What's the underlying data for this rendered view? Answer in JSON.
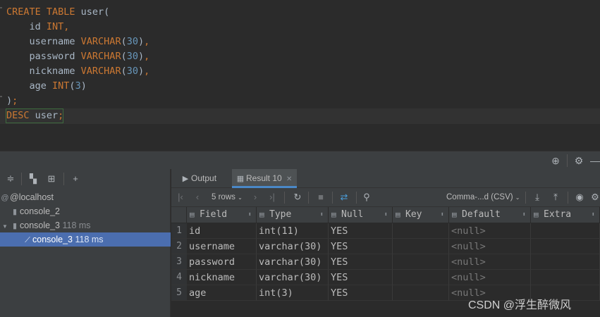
{
  "editor": {
    "lines": [
      [
        {
          "t": "CREATE TABLE ",
          "c": "kw"
        },
        {
          "t": "user(",
          "c": ""
        }
      ],
      [
        {
          "t": "    id ",
          "c": ""
        },
        {
          "t": "INT",
          "c": "kw"
        },
        {
          "t": ",",
          "c": "kw"
        }
      ],
      [
        {
          "t": "    username ",
          "c": ""
        },
        {
          "t": "VARCHAR",
          "c": "kw"
        },
        {
          "t": "(",
          "c": ""
        },
        {
          "t": "30",
          "c": "num"
        },
        {
          "t": ")",
          "c": ""
        },
        {
          "t": ",",
          "c": "kw"
        }
      ],
      [
        {
          "t": "    password ",
          "c": ""
        },
        {
          "t": "VARCHAR",
          "c": "kw"
        },
        {
          "t": "(",
          "c": ""
        },
        {
          "t": "30",
          "c": "num"
        },
        {
          "t": ")",
          "c": ""
        },
        {
          "t": ",",
          "c": "kw"
        }
      ],
      [
        {
          "t": "    nickname ",
          "c": ""
        },
        {
          "t": "VARCHAR",
          "c": "kw"
        },
        {
          "t": "(",
          "c": ""
        },
        {
          "t": "30",
          "c": "num"
        },
        {
          "t": ")",
          "c": ""
        },
        {
          "t": ",",
          "c": "kw"
        }
      ],
      [
        {
          "t": "    age ",
          "c": ""
        },
        {
          "t": "INT",
          "c": "kw"
        },
        {
          "t": "(",
          "c": ""
        },
        {
          "t": "3",
          "c": "num"
        },
        {
          "t": ")",
          "c": ""
        }
      ],
      [
        {
          "t": ")",
          "c": ""
        },
        {
          "t": ";",
          "c": "kw"
        }
      ],
      [
        {
          "t": "DESC ",
          "c": "kw"
        },
        {
          "t": "user",
          "c": ""
        },
        {
          "t": ";",
          "c": "kw"
        }
      ]
    ]
  },
  "tree": {
    "host": "@localhost",
    "console2": "console_2",
    "console3": "console_3",
    "console3_time": "118 ms",
    "session_label": "console_3",
    "session_time": "118 ms"
  },
  "tabs": {
    "output": "Output",
    "result": "Result 10"
  },
  "toolbar": {
    "rows": "5 rows",
    "export_format": "Comma-...d (CSV)"
  },
  "grid": {
    "columns": [
      "Field",
      "Type",
      "Null",
      "Key",
      "Default",
      "Extra"
    ],
    "rows": [
      [
        "1",
        "id",
        "int(11)",
        "YES",
        "",
        "<null>",
        ""
      ],
      [
        "2",
        "username",
        "varchar(30)",
        "YES",
        "",
        "<null>",
        ""
      ],
      [
        "3",
        "password",
        "varchar(30)",
        "YES",
        "",
        "<null>",
        ""
      ],
      [
        "4",
        "nickname",
        "varchar(30)",
        "YES",
        "",
        "<null>",
        ""
      ],
      [
        "5",
        "age",
        "int(3)",
        "YES",
        "",
        "<null>",
        ""
      ]
    ]
  },
  "watermark": "CSDN @浮生醉微风",
  "icons": [
    "gutter-tick",
    "target-icon",
    "gear-icon",
    "minus-icon",
    "collapse-icon",
    "tree-icon",
    "pin-icon",
    "add-icon",
    "host-icon",
    "console-icon",
    "chevron-icon",
    "output-icon",
    "table-icon",
    "close-icon",
    "first-icon",
    "prev-icon",
    "next-icon",
    "last-icon",
    "refresh-icon",
    "stop-icon",
    "transaction-icon",
    "pin-icon",
    "download-icon",
    "upload-icon",
    "eye-icon"
  ],
  "colors": {
    "keyword": "#cc7832",
    "number": "#6897bb",
    "selection": "#4b6eaf",
    "tab_accent": "#4a88c7"
  }
}
